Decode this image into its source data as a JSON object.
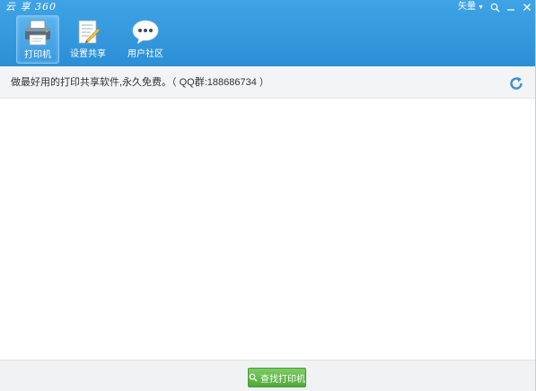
{
  "window": {
    "title": "云 享 360",
    "vector_dropdown": "矢量"
  },
  "nav": {
    "items": [
      {
        "label": "打印机",
        "icon": "printer-icon",
        "active": true
      },
      {
        "label": "设置共享",
        "icon": "share-settings-icon",
        "active": false
      },
      {
        "label": "用户社区",
        "icon": "chat-bubble-icon",
        "active": false
      }
    ]
  },
  "notice": {
    "text": "做最好用的打印共享软件,永久免费。（ QQ群:188686734 ）"
  },
  "footer": {
    "find_printer_label": "查找打印机"
  },
  "colors": {
    "header_blue": "#2c8fd6",
    "button_green": "#4faa3a",
    "notice_bg": "#f3f4f5"
  }
}
